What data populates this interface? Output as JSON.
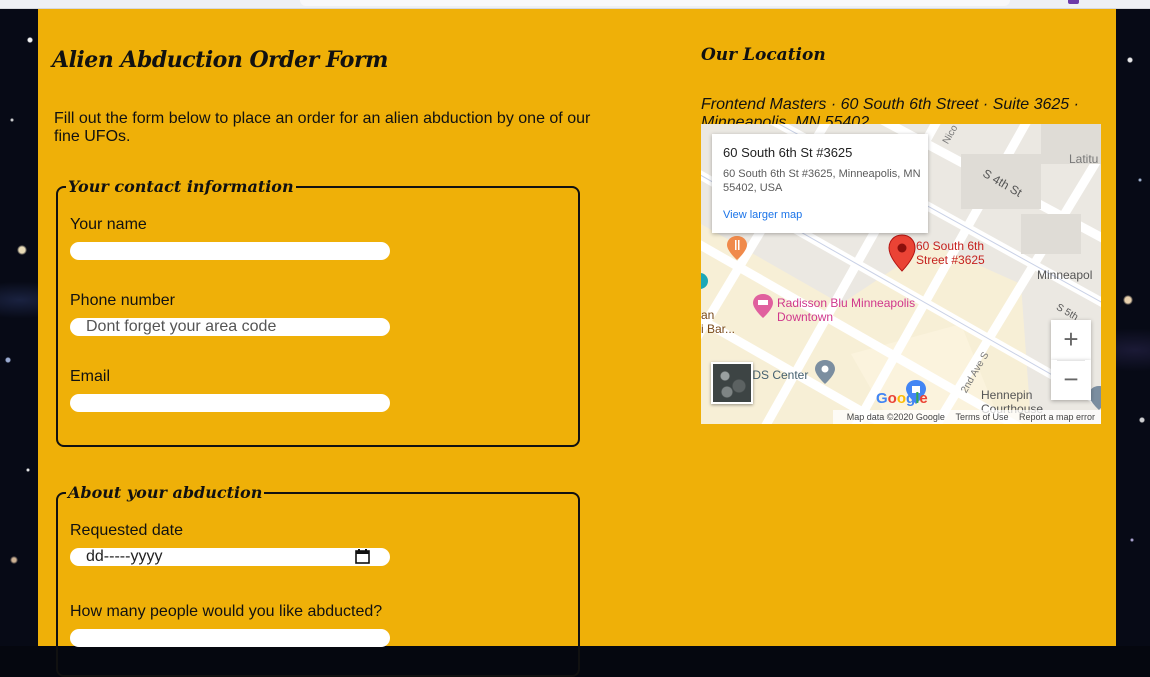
{
  "form": {
    "title": "Alien Abduction Order Form",
    "intro": "Fill out the form below to place an order for an alien abduction by one of our fine UFOs.",
    "contact": {
      "legend": "Your contact information",
      "name_label": "Your name",
      "name_value": "",
      "phone_label": "Phone number",
      "phone_placeholder": "Dont forget your area code",
      "email_label": "Email",
      "email_value": ""
    },
    "abduction": {
      "legend": "About your abduction",
      "date_label": "Requested date",
      "date_placeholder": "dd-----yyyy",
      "count_label": "How many people would you like abducted?",
      "count_value": ""
    }
  },
  "location": {
    "title": "Our Location",
    "address": "Frontend Masters · 60 South 6th Street · Suite 3625 · Minneapolis, MN 55402",
    "map": {
      "card_title": "60 South 6th St #3625",
      "card_address": "60 South 6th St #3625, Minneapolis, MN 55402, USA",
      "card_link": "View larger map",
      "pin_label": "60 South 6th Street #3625",
      "labels": {
        "radisson": "Radisson Blu Minneapolis Downtown",
        "ids_center": "IDS Center",
        "hennepin": "Hennepin Courthouse",
        "minneapolis": "Minneapol",
        "latitude": "Latitu",
        "s4th": "S 4th St",
        "s5th": "S 5th",
        "nicollet": "Nico",
        "second_ave": "2nd Ave S",
        "an_bar_1": "an",
        "an_bar_2": "i Bar..."
      },
      "zoom_in": "+",
      "zoom_out": "−",
      "google": "Google",
      "footer_data": "Map data ©2020 Google",
      "footer_terms": "Terms of Use",
      "footer_report": "Report a map error"
    }
  },
  "colors": {
    "page_background": "#efb008",
    "pin": "#ea4335",
    "link": "#1a73e8"
  }
}
